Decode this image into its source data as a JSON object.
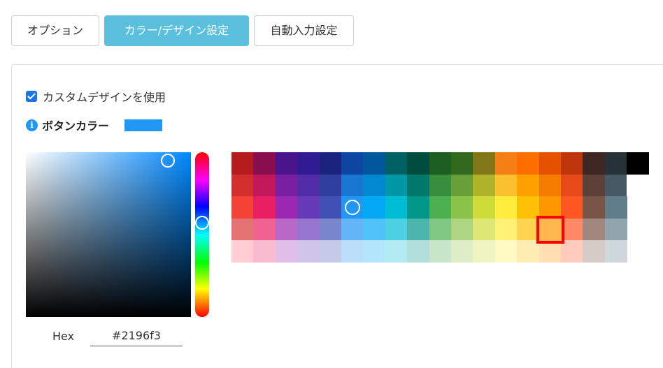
{
  "tabs": [
    {
      "label": "オプション",
      "active": false
    },
    {
      "label": "カラー/デザイン設定",
      "active": true
    },
    {
      "label": "自動入力設定",
      "active": false
    }
  ],
  "custom_design": {
    "label": "カスタムデザインを使用",
    "checked": true
  },
  "button_color": {
    "label": "ボタンカラー",
    "info_icon": "info-icon",
    "value": "#2196f3"
  },
  "picker": {
    "hex_label": "Hex",
    "hex_value": "#2196f3"
  },
  "palette": {
    "rows": [
      [
        "#b71c1c",
        "#880e4f",
        "#4a148c",
        "#311b92",
        "#1a237e",
        "#0d47a1",
        "#01579b",
        "#006064",
        "#004d40",
        "#1b5e20",
        "#33691e",
        "#827717",
        "#f57f17",
        "#ff6f00",
        "#e65100",
        "#bf360c",
        "#3e2723",
        "#263238",
        "#000000"
      ],
      [
        "#d32f2f",
        "#c2185b",
        "#7b1fa2",
        "#512da8",
        "#303f9f",
        "#1976d2",
        "#0288d1",
        "#0097a7",
        "#00796b",
        "#388e3c",
        "#689f38",
        "#afb42b",
        "#fbc02d",
        "#ffa000",
        "#f57c00",
        "#e64a19",
        "#5d4037",
        "#455a64",
        "#ffffff"
      ],
      [
        "#f44336",
        "#e91e63",
        "#9c27b0",
        "#673ab7",
        "#3f51b5",
        "#2196f3",
        "#03a9f4",
        "#00bcd4",
        "#009688",
        "#4caf50",
        "#8bc34a",
        "#cddc39",
        "#ffeb3b",
        "#ffc107",
        "#ff9800",
        "#ff5722",
        "#795548",
        "#607d8b"
      ],
      [
        "#e57373",
        "#f06292",
        "#ba68c8",
        "#9575cd",
        "#7986cb",
        "#64b5f6",
        "#4fc3f7",
        "#4dd0e1",
        "#4db6ac",
        "#81c784",
        "#aed581",
        "#dce775",
        "#fff176",
        "#ffd54f",
        "#ffb74d",
        "#ff8a65",
        "#a1887f",
        "#90a4ae"
      ],
      [
        "#ffcdd2",
        "#f8bbd0",
        "#e1bee7",
        "#d1c4e9",
        "#c5cae9",
        "#bbdefb",
        "#b3e5fc",
        "#b2ebf2",
        "#b2dfdb",
        "#c8e6c9",
        "#dcedc8",
        "#f0f4c3",
        "#fff9c4",
        "#ffecb3",
        "#ffe0b2",
        "#ffccbc",
        "#d7ccc8",
        "#cfd8dc"
      ]
    ],
    "selected": "#2196f3",
    "hovered": "#ffb74d"
  }
}
